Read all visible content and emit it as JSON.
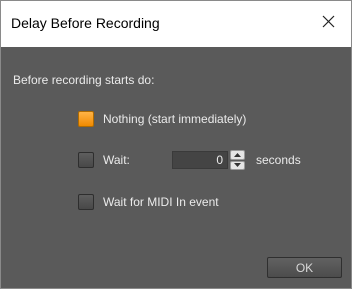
{
  "window": {
    "title": "Delay Before Recording",
    "close_glyph": "close-icon"
  },
  "dialog": {
    "prompt": "Before recording starts do:",
    "options": [
      {
        "label": "Nothing (start immediately)",
        "checked": true
      },
      {
        "label": "Wait:",
        "checked": false
      },
      {
        "label": "Wait for MIDI In event",
        "checked": false
      }
    ],
    "wait_value": "0",
    "wait_unit": "seconds",
    "ok_label": "OK"
  },
  "colors": {
    "accent": "#f08a00",
    "background": "#5a5a5a"
  }
}
